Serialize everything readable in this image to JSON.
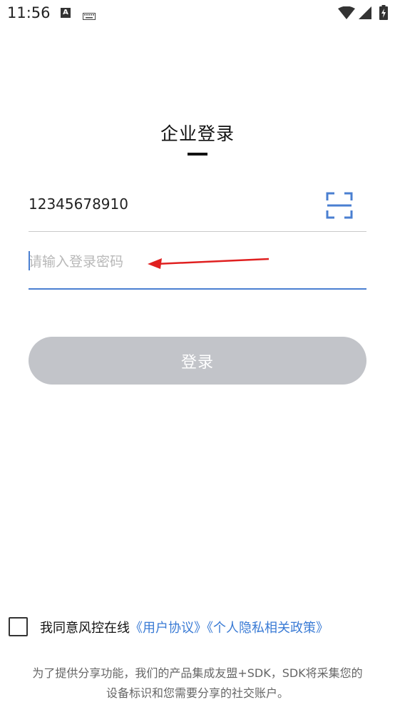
{
  "status_bar": {
    "time": "11:56",
    "notification_icon_letter": "A",
    "icons": [
      "a-notification-icon",
      "keyboard-icon",
      "wifi-icon",
      "signal-icon",
      "battery-icon"
    ]
  },
  "login": {
    "title": "企业登录",
    "account_value": "12345678910",
    "password_placeholder": "请输入登录密码",
    "login_button_label": "登录"
  },
  "agreement": {
    "text": "我同意风控在线",
    "user_agreement_link": "《用户协议》",
    "privacy_policy_link": "《个人隐私相关政策》"
  },
  "footer": {
    "line1": "为了提供分享功能，我们的产品集成友盟+SDK，SDK将采集您的",
    "line2": "设备标识和您需要分享的社交账户。"
  },
  "colors": {
    "accent": "#3a7bd5",
    "button_disabled": "#c2c4c9",
    "annotation_arrow": "#e02020"
  }
}
